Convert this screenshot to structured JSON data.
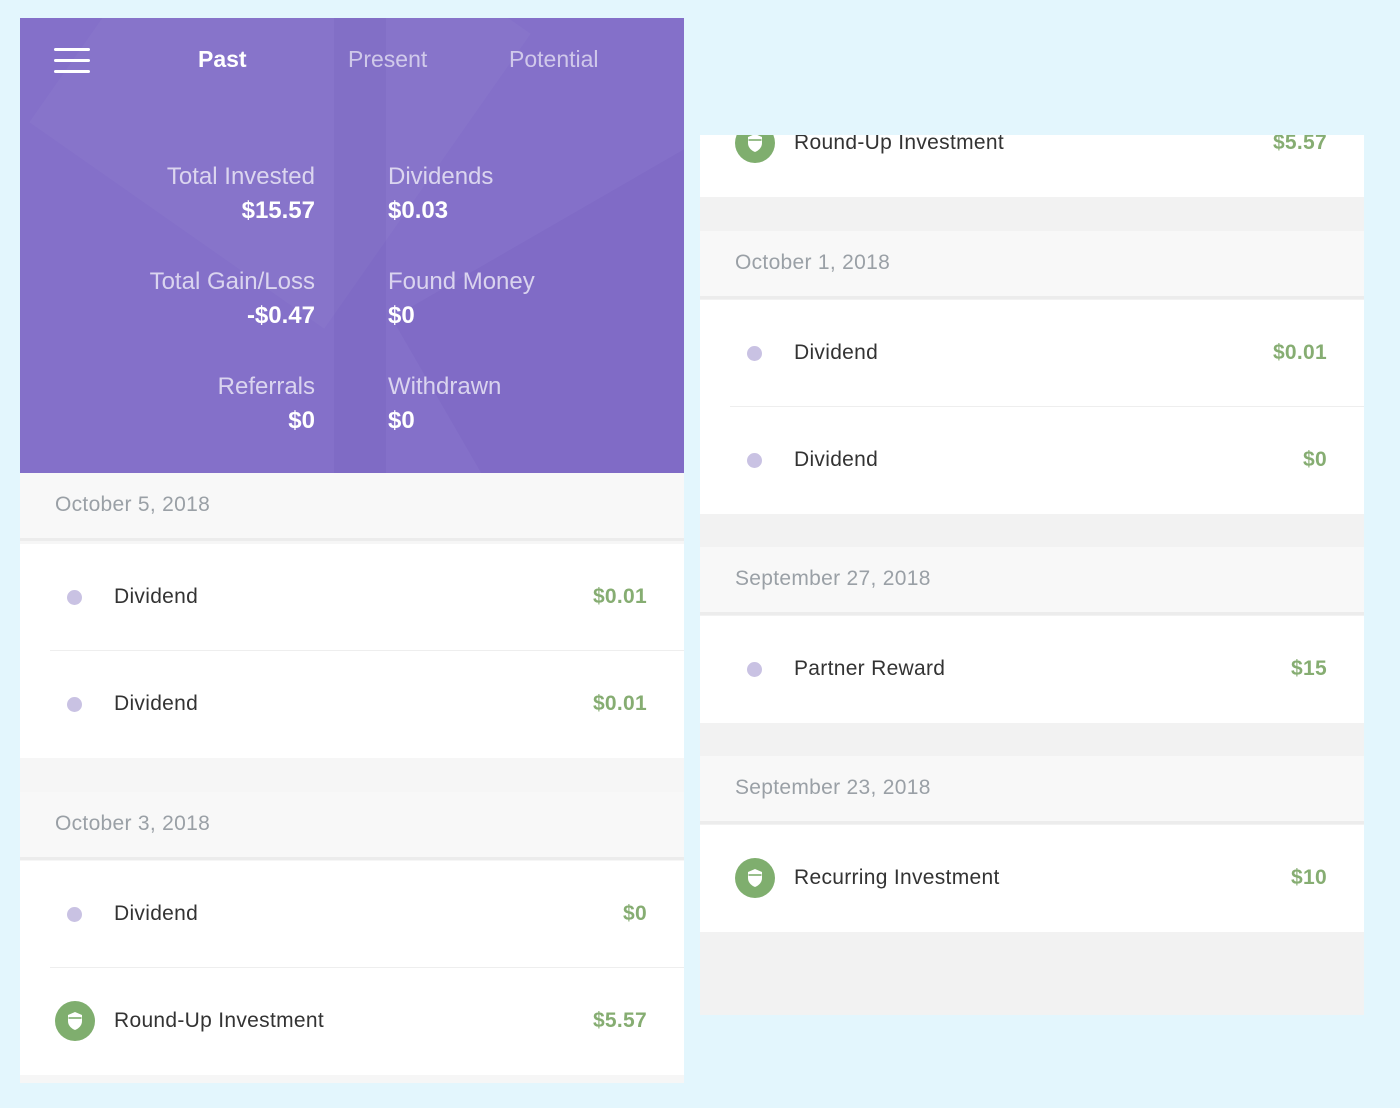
{
  "tabs": {
    "past": "Past",
    "present": "Present",
    "potential": "Potential"
  },
  "stats": {
    "total_invested": {
      "label": "Total Invested",
      "value": "$15.57"
    },
    "dividends": {
      "label": "Dividends",
      "value": "$0.03"
    },
    "total_gain_loss": {
      "label": "Total Gain/Loss",
      "value": "-$0.47"
    },
    "found_money": {
      "label": "Found Money",
      "value": "$0"
    },
    "referrals": {
      "label": "Referrals",
      "value": "$0"
    },
    "withdrawn": {
      "label": "Withdrawn",
      "value": "$0"
    }
  },
  "left": {
    "groups": [
      {
        "date": "October 5, 2018",
        "items": [
          {
            "name": "Dividend",
            "amount": "$0.01",
            "icon": "dot-icon"
          },
          {
            "name": "Dividend",
            "amount": "$0.01",
            "icon": "dot-icon"
          }
        ]
      },
      {
        "date": "October 3, 2018",
        "items": [
          {
            "name": "Dividend",
            "amount": "$0",
            "icon": "dot-icon"
          },
          {
            "name": "Round-Up Investment",
            "amount": "$5.57",
            "icon": "acorn-shield-icon"
          }
        ]
      }
    ]
  },
  "right": {
    "top_item": {
      "name": "Round-Up Investment",
      "amount": "$5.57",
      "icon": "acorn-shield-icon"
    },
    "groups": [
      {
        "date": "October 1, 2018",
        "items": [
          {
            "name": "Dividend",
            "amount": "$0.01",
            "icon": "dot-icon"
          },
          {
            "name": "Dividend",
            "amount": "$0",
            "icon": "dot-icon"
          }
        ]
      },
      {
        "date": "September 27, 2018",
        "items": [
          {
            "name": "Partner Reward",
            "amount": "$15",
            "icon": "dot-icon"
          }
        ]
      },
      {
        "date": "September 23, 2018",
        "items": [
          {
            "name": "Recurring Investment",
            "amount": "$10",
            "icon": "acorn-shield-icon"
          }
        ]
      }
    ]
  },
  "colors": {
    "header_purple": "#8470c9",
    "amount_green": "#86ad72",
    "dot_lavender": "#c9c2e3",
    "icon_green": "#7fae6e",
    "background": "#e3f6fd"
  }
}
